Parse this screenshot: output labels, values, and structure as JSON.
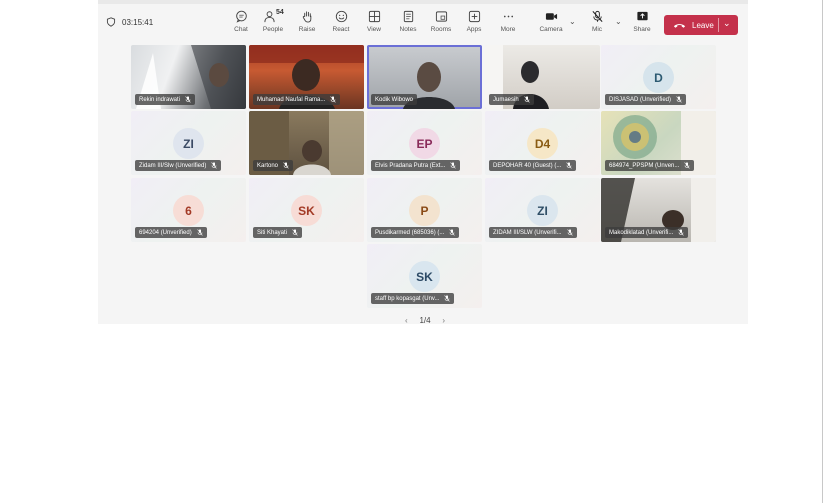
{
  "timer": "03:15:41",
  "toolbar": {
    "chat": "Chat",
    "people": "People",
    "people_count": "54",
    "raise": "Raise",
    "react": "React",
    "view": "View",
    "notes": "Notes",
    "rooms": "Rooms",
    "apps": "Apps",
    "more": "More",
    "camera": "Camera",
    "mic": "Mic",
    "share": "Share",
    "leave": "Leave"
  },
  "tiles": [
    {
      "name": "Rekin indrawati"
    },
    {
      "name": "Muhamad Naufal Rama..."
    },
    {
      "name": "Kodik Wibowo"
    },
    {
      "name": "Jumaesih"
    },
    {
      "name": "DISJASAD (Unverified)",
      "initials": "D",
      "avatar_bg": "#d6e4ec",
      "avatar_fg": "#2c5a72"
    },
    {
      "name": "Zidam III/Slw (Unverified)",
      "initials": "ZI",
      "avatar_bg": "#dfe5ee",
      "avatar_fg": "#3a4a64"
    },
    {
      "name": "Kartono"
    },
    {
      "name": "Elvis Pradana Putra (Ext...",
      "initials": "EP",
      "avatar_bg": "#f1d9e6",
      "avatar_fg": "#8a2b5a"
    },
    {
      "name": "DEPOHAR 40 (Guest) (...",
      "initials": "D4",
      "avatar_bg": "#f6e7c7",
      "avatar_fg": "#8a5b12"
    },
    {
      "name": "684974_PPSPM (Unven..."
    },
    {
      "name": "694204 (Unverified)",
      "initials": "6",
      "avatar_bg": "#f7ddd6",
      "avatar_fg": "#a33a26"
    },
    {
      "name": "Siti Khayati",
      "initials": "SK",
      "avatar_bg": "#f7dcd6",
      "avatar_fg": "#a33a26"
    },
    {
      "name": "Pusdikarmed (685036) (...",
      "initials": "P",
      "avatar_bg": "#f3e3cf",
      "avatar_fg": "#8a4a16"
    },
    {
      "name": "ZIDAM III/SLW (Unverifi...",
      "initials": "ZI",
      "avatar_bg": "#dbe6ee",
      "avatar_fg": "#2f4e66"
    },
    {
      "name": "Makodiklatad (Unverifi..."
    },
    {
      "name": "staff bp kopasgat (Unv...",
      "initials": "SK",
      "avatar_bg": "#d9e6ef",
      "avatar_fg": "#2c4a66"
    }
  ],
  "pager": "1/4",
  "colors": {
    "leave": "#c4314b",
    "active_speaker": "#6b6fd6"
  }
}
